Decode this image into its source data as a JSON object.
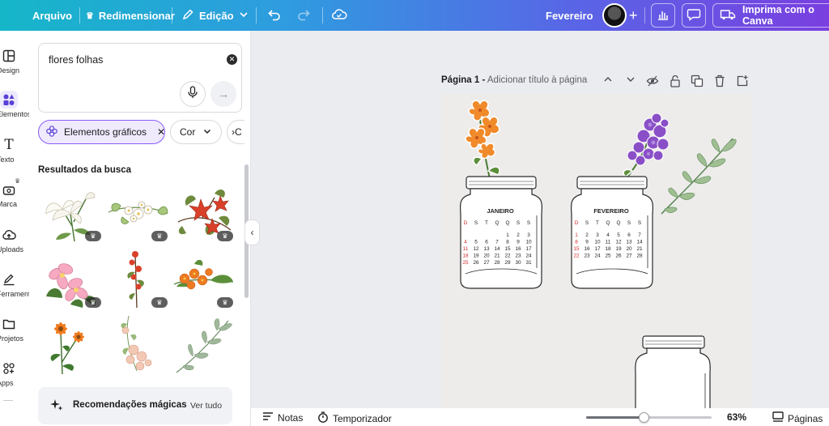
{
  "topbar": {
    "file_menu": "Arquivo",
    "resize_label": "Redimensionar",
    "edit_label": "Edição",
    "doc_title": "Fevereiro",
    "print_label": "Imprima com o Canva"
  },
  "rail": {
    "items": [
      {
        "label": "Design",
        "icon": "layout-icon"
      },
      {
        "label": "Elementos",
        "icon": "shapes-icon"
      },
      {
        "label": "Texto",
        "icon": "text-icon"
      },
      {
        "label": "Marca",
        "icon": "brand-icon"
      },
      {
        "label": "Uploads",
        "icon": "cloud-upload-icon"
      },
      {
        "label": "Ferramentas",
        "icon": "draw-icon"
      },
      {
        "label": "Projetos",
        "icon": "folder-icon"
      },
      {
        "label": "Apps",
        "icon": "apps-icon"
      }
    ]
  },
  "panel": {
    "search_value": "flores folhas",
    "chips": {
      "graphics": "Elementos gráficos",
      "color": "Cor"
    },
    "results_title": "Resultados da busca",
    "magic_label": "Recomendações mágicas",
    "magic_link": "Ver tudo"
  },
  "page": {
    "label": "Página 1 -",
    "title_placeholder": "Adicionar título à página"
  },
  "calendars": [
    {
      "month": "JANEIRO",
      "weekdays": [
        "D",
        "S",
        "T",
        "Q",
        "Q",
        "S",
        "S"
      ],
      "weeks": [
        [
          "",
          "",
          "",
          "",
          "1",
          "2",
          "3"
        ],
        [
          "4",
          "5",
          "6",
          "7",
          "8",
          "9",
          "10"
        ],
        [
          "11",
          "12",
          "13",
          "14",
          "15",
          "16",
          "17"
        ],
        [
          "18",
          "19",
          "20",
          "21",
          "22",
          "23",
          "24"
        ],
        [
          "25",
          "26",
          "27",
          "28",
          "29",
          "30",
          "31"
        ]
      ]
    },
    {
      "month": "FEVEREIRO",
      "weekdays": [
        "D",
        "S",
        "T",
        "Q",
        "Q",
        "S",
        "S"
      ],
      "weeks": [
        [
          "1",
          "2",
          "3",
          "4",
          "5",
          "6",
          "7"
        ],
        [
          "8",
          "9",
          "10",
          "11",
          "12",
          "13",
          "14"
        ],
        [
          "15",
          "16",
          "17",
          "18",
          "19",
          "20",
          "21"
        ],
        [
          "22",
          "23",
          "24",
          "25",
          "26",
          "27",
          "28"
        ]
      ]
    }
  ],
  "bottombar": {
    "notes_label": "Notas",
    "timer_label": "Temporizador",
    "zoom_percent": 63,
    "zoom_label": "63%",
    "pages_label": "Páginas"
  },
  "colors": {
    "accent": "#8b5cf6",
    "sunday_red": "#d22a2a"
  }
}
